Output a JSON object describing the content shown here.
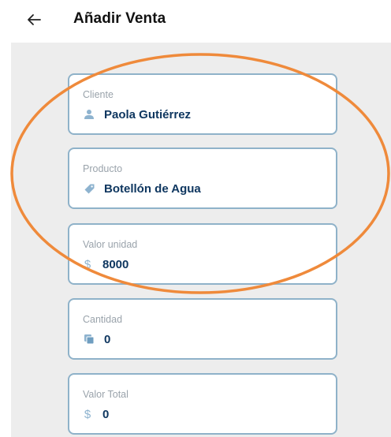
{
  "header": {
    "back_icon": "arrow-left-icon",
    "title": "Añadir Venta"
  },
  "fields": {
    "cliente": {
      "label": "Cliente",
      "value": "Paola Gutiérrez",
      "icon": "person-icon"
    },
    "producto": {
      "label": "Producto",
      "value": "Botellón de Agua",
      "icon": "tag-icon"
    },
    "valor_unidad": {
      "label": "Valor unidad",
      "value": "8000",
      "icon": "$"
    },
    "cantidad": {
      "label": "Cantidad",
      "value": "0",
      "icon": "stack-icon"
    },
    "valor_total": {
      "label": "Valor Total",
      "value": "0",
      "icon": "$"
    }
  },
  "colors": {
    "field_border": "#8fb2c9",
    "value_text": "#0f3760",
    "label_text": "#9aa3ab",
    "icon": "#8eb3cf",
    "highlight": "#ef8a3b",
    "form_background": "#ededed"
  }
}
